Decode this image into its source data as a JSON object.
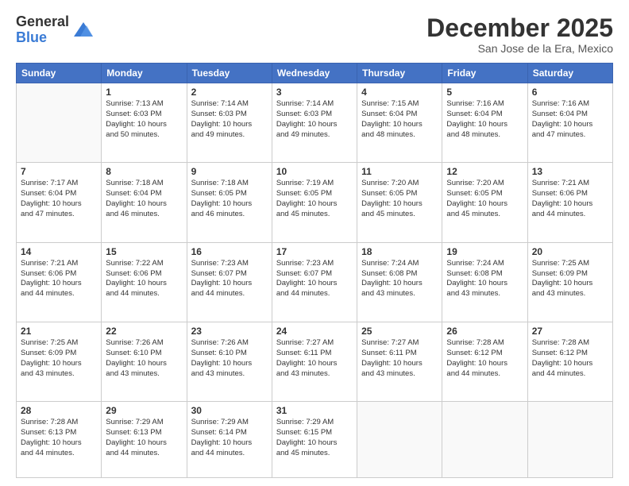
{
  "logo": {
    "general": "General",
    "blue": "Blue"
  },
  "header": {
    "month": "December 2025",
    "location": "San Jose de la Era, Mexico"
  },
  "days_of_week": [
    "Sunday",
    "Monday",
    "Tuesday",
    "Wednesday",
    "Thursday",
    "Friday",
    "Saturday"
  ],
  "weeks": [
    [
      {
        "day": "",
        "info": ""
      },
      {
        "day": "1",
        "info": "Sunrise: 7:13 AM\nSunset: 6:03 PM\nDaylight: 10 hours\nand 50 minutes."
      },
      {
        "day": "2",
        "info": "Sunrise: 7:14 AM\nSunset: 6:03 PM\nDaylight: 10 hours\nand 49 minutes."
      },
      {
        "day": "3",
        "info": "Sunrise: 7:14 AM\nSunset: 6:03 PM\nDaylight: 10 hours\nand 49 minutes."
      },
      {
        "day": "4",
        "info": "Sunrise: 7:15 AM\nSunset: 6:04 PM\nDaylight: 10 hours\nand 48 minutes."
      },
      {
        "day": "5",
        "info": "Sunrise: 7:16 AM\nSunset: 6:04 PM\nDaylight: 10 hours\nand 48 minutes."
      },
      {
        "day": "6",
        "info": "Sunrise: 7:16 AM\nSunset: 6:04 PM\nDaylight: 10 hours\nand 47 minutes."
      }
    ],
    [
      {
        "day": "7",
        "info": "Sunrise: 7:17 AM\nSunset: 6:04 PM\nDaylight: 10 hours\nand 47 minutes."
      },
      {
        "day": "8",
        "info": "Sunrise: 7:18 AM\nSunset: 6:04 PM\nDaylight: 10 hours\nand 46 minutes."
      },
      {
        "day": "9",
        "info": "Sunrise: 7:18 AM\nSunset: 6:05 PM\nDaylight: 10 hours\nand 46 minutes."
      },
      {
        "day": "10",
        "info": "Sunrise: 7:19 AM\nSunset: 6:05 PM\nDaylight: 10 hours\nand 45 minutes."
      },
      {
        "day": "11",
        "info": "Sunrise: 7:20 AM\nSunset: 6:05 PM\nDaylight: 10 hours\nand 45 minutes."
      },
      {
        "day": "12",
        "info": "Sunrise: 7:20 AM\nSunset: 6:05 PM\nDaylight: 10 hours\nand 45 minutes."
      },
      {
        "day": "13",
        "info": "Sunrise: 7:21 AM\nSunset: 6:06 PM\nDaylight: 10 hours\nand 44 minutes."
      }
    ],
    [
      {
        "day": "14",
        "info": "Sunrise: 7:21 AM\nSunset: 6:06 PM\nDaylight: 10 hours\nand 44 minutes."
      },
      {
        "day": "15",
        "info": "Sunrise: 7:22 AM\nSunset: 6:06 PM\nDaylight: 10 hours\nand 44 minutes."
      },
      {
        "day": "16",
        "info": "Sunrise: 7:23 AM\nSunset: 6:07 PM\nDaylight: 10 hours\nand 44 minutes."
      },
      {
        "day": "17",
        "info": "Sunrise: 7:23 AM\nSunset: 6:07 PM\nDaylight: 10 hours\nand 44 minutes."
      },
      {
        "day": "18",
        "info": "Sunrise: 7:24 AM\nSunset: 6:08 PM\nDaylight: 10 hours\nand 43 minutes."
      },
      {
        "day": "19",
        "info": "Sunrise: 7:24 AM\nSunset: 6:08 PM\nDaylight: 10 hours\nand 43 minutes."
      },
      {
        "day": "20",
        "info": "Sunrise: 7:25 AM\nSunset: 6:09 PM\nDaylight: 10 hours\nand 43 minutes."
      }
    ],
    [
      {
        "day": "21",
        "info": "Sunrise: 7:25 AM\nSunset: 6:09 PM\nDaylight: 10 hours\nand 43 minutes."
      },
      {
        "day": "22",
        "info": "Sunrise: 7:26 AM\nSunset: 6:10 PM\nDaylight: 10 hours\nand 43 minutes."
      },
      {
        "day": "23",
        "info": "Sunrise: 7:26 AM\nSunset: 6:10 PM\nDaylight: 10 hours\nand 43 minutes."
      },
      {
        "day": "24",
        "info": "Sunrise: 7:27 AM\nSunset: 6:11 PM\nDaylight: 10 hours\nand 43 minutes."
      },
      {
        "day": "25",
        "info": "Sunrise: 7:27 AM\nSunset: 6:11 PM\nDaylight: 10 hours\nand 43 minutes."
      },
      {
        "day": "26",
        "info": "Sunrise: 7:28 AM\nSunset: 6:12 PM\nDaylight: 10 hours\nand 44 minutes."
      },
      {
        "day": "27",
        "info": "Sunrise: 7:28 AM\nSunset: 6:12 PM\nDaylight: 10 hours\nand 44 minutes."
      }
    ],
    [
      {
        "day": "28",
        "info": "Sunrise: 7:28 AM\nSunset: 6:13 PM\nDaylight: 10 hours\nand 44 minutes."
      },
      {
        "day": "29",
        "info": "Sunrise: 7:29 AM\nSunset: 6:13 PM\nDaylight: 10 hours\nand 44 minutes."
      },
      {
        "day": "30",
        "info": "Sunrise: 7:29 AM\nSunset: 6:14 PM\nDaylight: 10 hours\nand 44 minutes."
      },
      {
        "day": "31",
        "info": "Sunrise: 7:29 AM\nSunset: 6:15 PM\nDaylight: 10 hours\nand 45 minutes."
      },
      {
        "day": "",
        "info": ""
      },
      {
        "day": "",
        "info": ""
      },
      {
        "day": "",
        "info": ""
      }
    ]
  ]
}
